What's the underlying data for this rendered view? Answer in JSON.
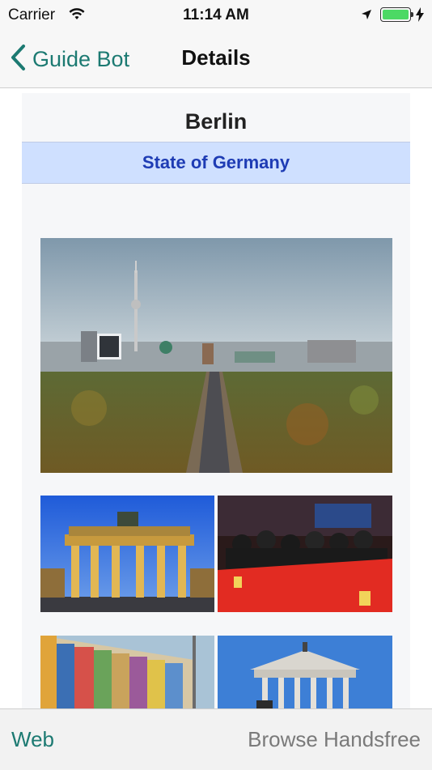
{
  "status_bar": {
    "carrier": "Carrier",
    "time": "11:14 AM",
    "battery_color": "#4cd964",
    "icons": [
      "wifi-icon",
      "location-arrow-icon",
      "battery-icon",
      "charging-bolt-icon"
    ]
  },
  "navbar": {
    "back_label": "Guide Bot",
    "title": "Details",
    "accent_color": "#1c7a72"
  },
  "detail": {
    "city": "Berlin",
    "state": "State of Germany",
    "state_bar_color": "#cfe0ff",
    "images": [
      {
        "name": "berlin-skyline-photo",
        "depicts": "Berlin skyline with TV tower over Tiergarten"
      },
      {
        "name": "brandenburg-gate-photo",
        "depicts": "Brandenburg Gate at dusk"
      },
      {
        "name": "berlinale-crowd-photo",
        "depicts": "Photographers at Berlinale red wall"
      },
      {
        "name": "berlin-wall-art-photo",
        "depicts": "Painted Berlin Wall"
      },
      {
        "name": "alte-nationalgalerie-photo",
        "depicts": "Alte Nationalgalerie museum"
      }
    ]
  },
  "tabbar": {
    "left_label": "Web",
    "right_label": "Browse Handsfree"
  }
}
